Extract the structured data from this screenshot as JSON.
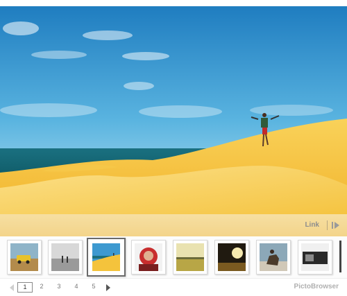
{
  "caption": {
    "link_label": "Link"
  },
  "thumbnails": [
    {
      "name": "thumb-yellow-car"
    },
    {
      "name": "thumb-bw-beach"
    },
    {
      "name": "thumb-desert-dune"
    },
    {
      "name": "thumb-portrait"
    },
    {
      "name": "thumb-field-sunset"
    },
    {
      "name": "thumb-sun-glare"
    },
    {
      "name": "thumb-horse-rider"
    },
    {
      "name": "thumb-dark-room"
    }
  ],
  "selected_thumbnail": 3,
  "pager": {
    "pages": [
      "1",
      "2",
      "3",
      "4",
      "5"
    ],
    "current_page": "1"
  },
  "brand": "PictoBrowser",
  "colors": {
    "sky": "#2d8fc8",
    "sand": "#f2c43e",
    "sea": "#1b6d7c",
    "accent_bar": "#f4d690"
  }
}
